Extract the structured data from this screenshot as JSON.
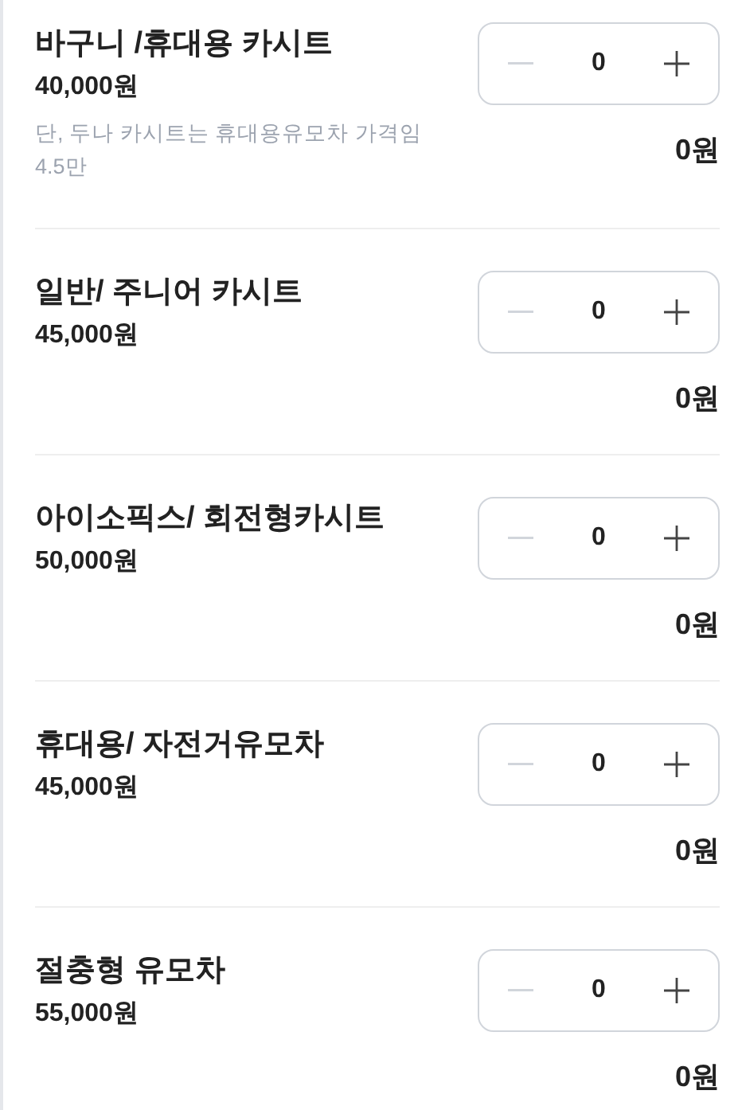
{
  "items": [
    {
      "name": "바구니 /휴대용 카시트",
      "price": "40,000원",
      "note": "단, 두나 카시트는 휴대용유모차 가격임 4.5만",
      "quantity": "0",
      "minus_disabled": true,
      "total": "0원"
    },
    {
      "name": "일반/ 주니어 카시트",
      "price": "45,000원",
      "quantity": "0",
      "minus_disabled": true,
      "total": "0원"
    },
    {
      "name": "아이소픽스/ 회전형카시트",
      "price": "50,000원",
      "quantity": "0",
      "minus_disabled": true,
      "total": "0원"
    },
    {
      "name": "휴대용/ 자전거유모차",
      "price": "45,000원",
      "quantity": "0",
      "minus_disabled": true,
      "total": "0원"
    },
    {
      "name": "절충형 유모차",
      "price": "55,000원",
      "quantity": "0",
      "minus_disabled": true,
      "total": "0원"
    }
  ]
}
